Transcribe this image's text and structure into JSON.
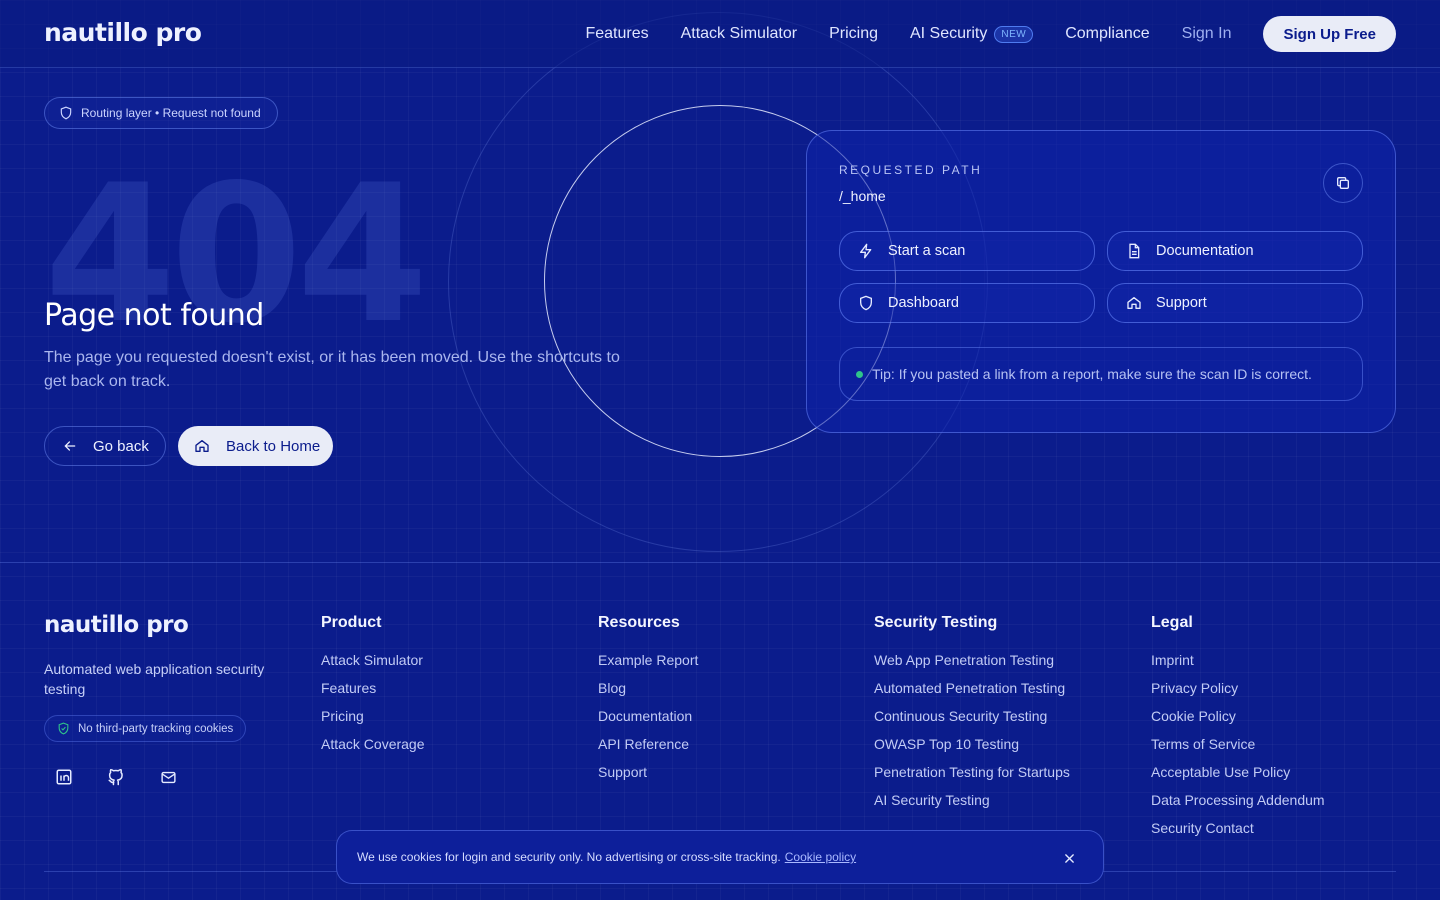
{
  "header": {
    "logo": "nautillo pro",
    "nav": [
      {
        "label": "Features"
      },
      {
        "label": "Attack Simulator"
      },
      {
        "label": "Pricing"
      },
      {
        "label": "AI Security",
        "badge": "NEW"
      },
      {
        "label": "Compliance"
      }
    ],
    "sign_in": "Sign In",
    "sign_up": "Sign Up Free"
  },
  "hero": {
    "chip": "Routing layer • Request not found",
    "code": "404",
    "title": "Page not found",
    "description": "The page you requested doesn't exist, or it has been moved. Use the shortcuts to get back on track.",
    "back_label": "Go back",
    "home_label": "Back to Home"
  },
  "card": {
    "label": "REQUESTED PATH",
    "path": "/_home",
    "actions": [
      {
        "label": "Start a scan",
        "icon": "bolt-icon"
      },
      {
        "label": "Documentation",
        "icon": "document-icon"
      },
      {
        "label": "Dashboard",
        "icon": "shield-icon"
      },
      {
        "label": "Support",
        "icon": "home-icon"
      }
    ],
    "tip": "Tip: If you pasted a link from a report, make sure the scan ID is correct."
  },
  "footer": {
    "logo": "nautillo pro",
    "tagline": "Automated web application security testing",
    "privacy_chip": "No third-party tracking cookies",
    "columns": [
      {
        "title": "Product",
        "links": [
          "Attack Simulator",
          "Features",
          "Pricing",
          "Attack Coverage"
        ]
      },
      {
        "title": "Resources",
        "links": [
          "Example Report",
          "Blog",
          "Documentation",
          "API Reference",
          "Support"
        ]
      },
      {
        "title": "Security Testing",
        "links": [
          "Web App Penetration Testing",
          "Automated Penetration Testing",
          "Continuous Security Testing",
          "OWASP Top 10 Testing",
          "Penetration Testing for Startups",
          "AI Security Testing"
        ]
      },
      {
        "title": "Legal",
        "links": [
          "Imprint",
          "Privacy Policy",
          "Cookie Policy",
          "Terms of Service",
          "Acceptable Use Policy",
          "Data Processing Addendum",
          "Security Contact"
        ]
      }
    ]
  },
  "cookie": {
    "text": "We use cookies for login and security only. No advertising or cross-site tracking.",
    "link": "Cookie policy"
  },
  "colors": {
    "background": "#0b1c8c",
    "accent": "#e9ecf7",
    "tip_dot": "#2fc48a"
  }
}
